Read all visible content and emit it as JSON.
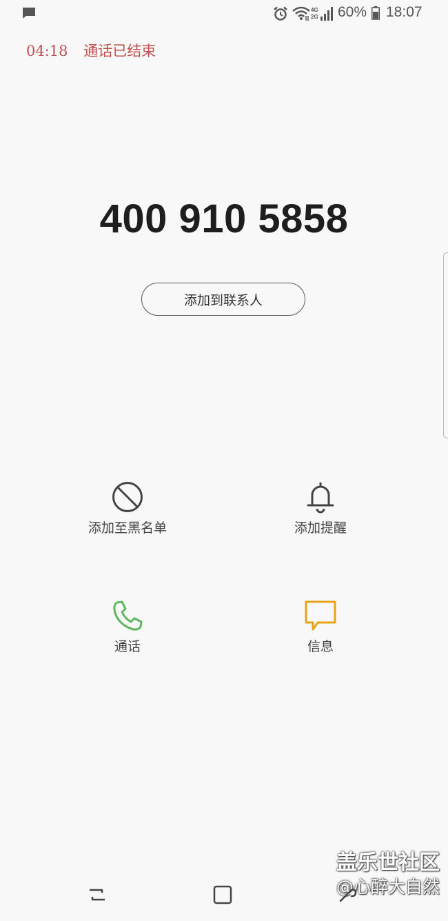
{
  "status_bar": {
    "icons": [
      "message-icon",
      "alarm-icon",
      "wifi-icon",
      "cellular-signal-icon",
      "battery-icon"
    ],
    "network_4g": "4G",
    "network_2g": "2G",
    "battery_percent": "60%",
    "time": "18:07"
  },
  "call": {
    "duration": "04:18",
    "status": "通话已结束",
    "number": "400 910 5858",
    "add_contact_label": "添加到联系人"
  },
  "actions": {
    "block": {
      "label": "添加至黑名单",
      "icon": "block-icon"
    },
    "reminder": {
      "label": "添加提醒",
      "icon": "bell-icon"
    },
    "call": {
      "label": "通话",
      "icon": "phone-icon"
    },
    "message": {
      "label": "信息",
      "icon": "message-bubble-icon"
    }
  },
  "colors": {
    "status_red": "#c0504d",
    "call_green": "#5cb85c",
    "message_yellow": "#e8a317",
    "background": "#f8f8f8"
  },
  "watermark": {
    "site": "盖乐世社区",
    "user": "@心醉大自然"
  },
  "nav_bar": {
    "items": [
      "recent-apps-icon",
      "home-icon",
      "back-icon"
    ]
  }
}
